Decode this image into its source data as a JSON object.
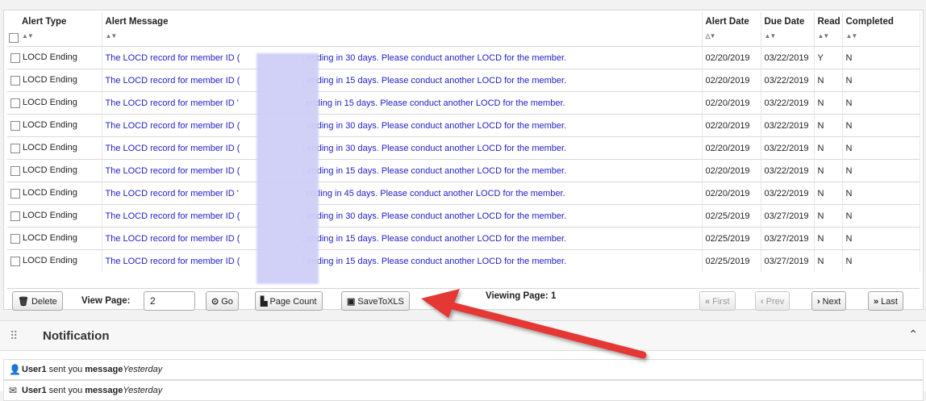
{
  "columns": {
    "type": "Alert Type",
    "message": "Alert Message",
    "alert_date": "Alert Date",
    "due_date": "Due Date",
    "read": "Read",
    "completed": "Completed"
  },
  "rows": [
    {
      "type": "LOCD Ending",
      "msg_a": "The LOCD record for member ID (",
      "msg_b": "; ending in 30 days. Please conduct another LOCD for the member.",
      "alert_date": "02/20/2019",
      "due_date": "03/22/2019",
      "read": "Y",
      "completed": "N"
    },
    {
      "type": "LOCD Ending",
      "msg_a": "The LOCD record for member ID (",
      "msg_b": "; ending in 15 days. Please conduct another LOCD for the member.",
      "alert_date": "02/20/2019",
      "due_date": "03/22/2019",
      "read": "N",
      "completed": "N"
    },
    {
      "type": "LOCD Ending",
      "msg_a": "The LOCD record for member ID '",
      "msg_b": "; ending in 15 days. Please conduct another LOCD for the member.",
      "alert_date": "02/20/2019",
      "due_date": "03/22/2019",
      "read": "N",
      "completed": "N"
    },
    {
      "type": "LOCD Ending",
      "msg_a": "The LOCD record for member ID (",
      "msg_b": "; ending in 30 days. Please conduct another LOCD for the member.",
      "alert_date": "02/20/2019",
      "due_date": "03/22/2019",
      "read": "N",
      "completed": "N"
    },
    {
      "type": "LOCD Ending",
      "msg_a": "The LOCD record for member ID (",
      "msg_b": "; ending in 30 days. Please conduct another LOCD for the member.",
      "alert_date": "02/20/2019",
      "due_date": "03/22/2019",
      "read": "N",
      "completed": "N"
    },
    {
      "type": "LOCD Ending",
      "msg_a": "The LOCD record for member ID (",
      "msg_b": "; ending in 15 days. Please conduct another LOCD for the member.",
      "alert_date": "02/20/2019",
      "due_date": "03/22/2019",
      "read": "N",
      "completed": "N"
    },
    {
      "type": "LOCD Ending",
      "msg_a": "The LOCD record for member ID '",
      "msg_b": "; ending in 45 days. Please conduct another LOCD for the member.",
      "alert_date": "02/20/2019",
      "due_date": "03/22/2019",
      "read": "N",
      "completed": "N"
    },
    {
      "type": "LOCD Ending",
      "msg_a": "The LOCD record for member ID (",
      "msg_b": "; ending in 30 days. Please conduct another LOCD for the member.",
      "alert_date": "02/25/2019",
      "due_date": "03/27/2019",
      "read": "N",
      "completed": "N"
    },
    {
      "type": "LOCD Ending",
      "msg_a": "The LOCD record for member ID (",
      "msg_b": "; ending in 15 days. Please conduct another LOCD for the member.",
      "alert_date": "02/25/2019",
      "due_date": "03/27/2019",
      "read": "N",
      "completed": "N"
    },
    {
      "type": "LOCD Ending",
      "msg_a": "The LOCD record for member ID (",
      "msg_b": "; ending in 15 days. Please conduct another LOCD for the member.",
      "alert_date": "02/25/2019",
      "due_date": "03/27/2019",
      "read": "N",
      "completed": "N"
    }
  ],
  "toolbar": {
    "delete": "Delete",
    "view_page_label": "View Page:",
    "view_page_value": "2",
    "go": "Go",
    "page_count": "Page Count",
    "save_xls": "SaveToXLS",
    "viewing": "Viewing Page: 1",
    "first": "First",
    "prev": "Prev",
    "next": "Next",
    "last": "Last"
  },
  "notification": {
    "title": "Notification",
    "items": [
      {
        "user": "User1",
        "text": " sent you ",
        "bold": "message",
        "when": "Yesterday"
      },
      {
        "user": "User1",
        "text": " sent you ",
        "bold": "message",
        "when": "Yesterday"
      }
    ]
  },
  "colors": {
    "link": "#1e1ec8",
    "arrow": "#e53935"
  }
}
